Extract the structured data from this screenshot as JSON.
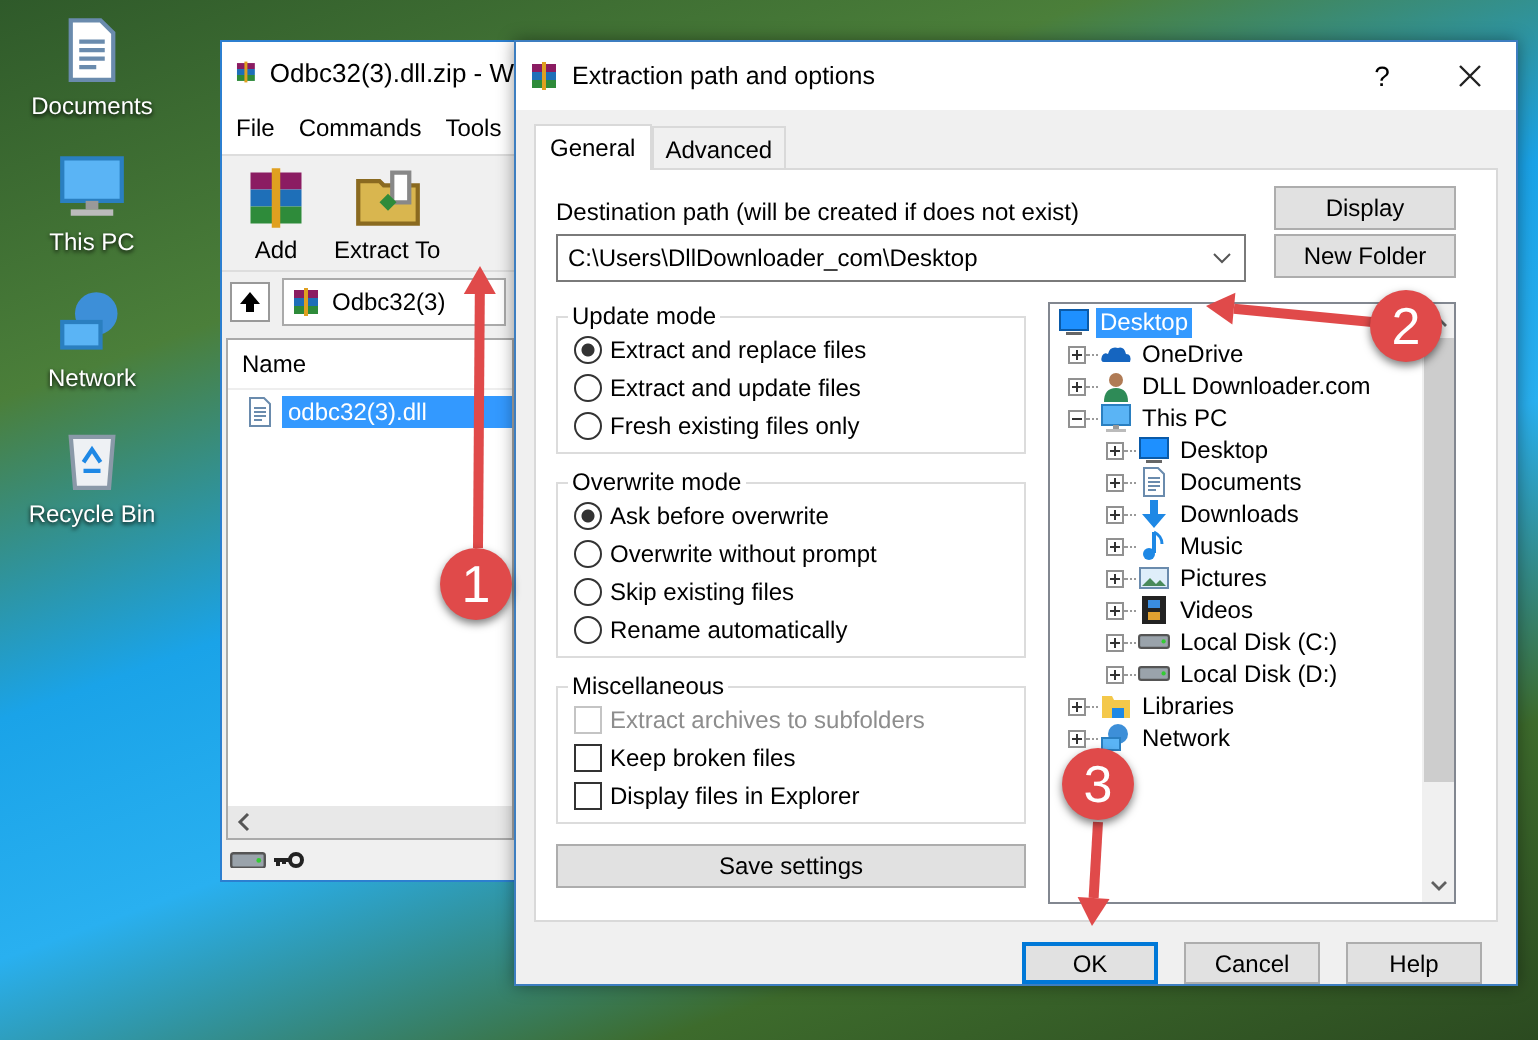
{
  "desktop_icons": [
    {
      "label": "Documents",
      "kind": "documents"
    },
    {
      "label": "This PC",
      "kind": "pc"
    },
    {
      "label": "Network",
      "kind": "network"
    },
    {
      "label": "Recycle Bin",
      "kind": "recycle"
    }
  ],
  "archive_window": {
    "title": "Odbc32(3).dll.zip - W",
    "menu": [
      "File",
      "Commands",
      "Tools"
    ],
    "toolbar": [
      {
        "label": "Add",
        "kind": "add"
      },
      {
        "label": "Extract To",
        "kind": "extract"
      }
    ],
    "address": "Odbc32(3)",
    "columns": [
      "Name"
    ],
    "files": [
      {
        "name": "odbc32(3).dll",
        "selected": true
      }
    ]
  },
  "dialog": {
    "title": "Extraction path and options",
    "help_glyph": "?",
    "tabs": [
      {
        "label": "General",
        "selected": true
      },
      {
        "label": "Advanced",
        "selected": false
      }
    ],
    "destination_label": "Destination path (will be created if does not exist)",
    "destination_path": "C:\\Users\\DllDownloader_com\\Desktop",
    "side_buttons": [
      "Display",
      "New Folder"
    ],
    "groups": [
      {
        "title": "Update mode",
        "kind": "radio",
        "options": [
          {
            "label": "Extract and replace files",
            "selected": true
          },
          {
            "label": "Extract and update files",
            "selected": false
          },
          {
            "label": "Fresh existing files only",
            "selected": false
          }
        ]
      },
      {
        "title": "Overwrite mode",
        "kind": "radio",
        "options": [
          {
            "label": "Ask before overwrite",
            "selected": true
          },
          {
            "label": "Overwrite without prompt",
            "selected": false
          },
          {
            "label": "Skip existing files",
            "selected": false
          },
          {
            "label": "Rename automatically",
            "selected": false
          }
        ]
      },
      {
        "title": "Miscellaneous",
        "kind": "checkbox",
        "options": [
          {
            "label": "Extract archives to subfolders",
            "checked": false,
            "disabled": true
          },
          {
            "label": "Keep broken files",
            "checked": false,
            "disabled": false
          },
          {
            "label": "Display files in Explorer",
            "checked": false,
            "disabled": false
          }
        ]
      }
    ],
    "save_button": "Save settings",
    "tree": [
      {
        "label": "Desktop",
        "kind": "desktop",
        "selected": true,
        "children": [
          {
            "label": "OneDrive",
            "kind": "cloud",
            "selected": false,
            "expanded": false
          },
          {
            "label": "DLL Downloader.com",
            "kind": "user",
            "selected": false,
            "expanded": false
          },
          {
            "label": "This PC",
            "kind": "pc",
            "selected": false,
            "expanded": true,
            "children": [
              {
                "label": "Desktop",
                "kind": "desktop",
                "selected": false,
                "expanded": false
              },
              {
                "label": "Documents",
                "kind": "documents",
                "selected": false,
                "expanded": false
              },
              {
                "label": "Downloads",
                "kind": "downloads",
                "selected": false,
                "expanded": false
              },
              {
                "label": "Music",
                "kind": "music",
                "selected": false,
                "expanded": false
              },
              {
                "label": "Pictures",
                "kind": "pictures",
                "selected": false,
                "expanded": false
              },
              {
                "label": "Videos",
                "kind": "videos",
                "selected": false,
                "expanded": false
              },
              {
                "label": "Local Disk (C:)",
                "kind": "disk",
                "selected": false,
                "expanded": false
              },
              {
                "label": "Local Disk (D:)",
                "kind": "disk",
                "selected": false,
                "expanded": false
              }
            ]
          },
          {
            "label": "Libraries",
            "kind": "libraries",
            "selected": false,
            "expanded": false
          },
          {
            "label": "Network",
            "kind": "network",
            "selected": false,
            "expanded": false
          }
        ]
      }
    ],
    "buttons": [
      {
        "label": "OK",
        "default": true
      },
      {
        "label": "Cancel",
        "default": false
      },
      {
        "label": "Help",
        "default": false
      }
    ]
  },
  "annotations": [
    {
      "number": "1"
    },
    {
      "number": "2"
    },
    {
      "number": "3"
    }
  ]
}
